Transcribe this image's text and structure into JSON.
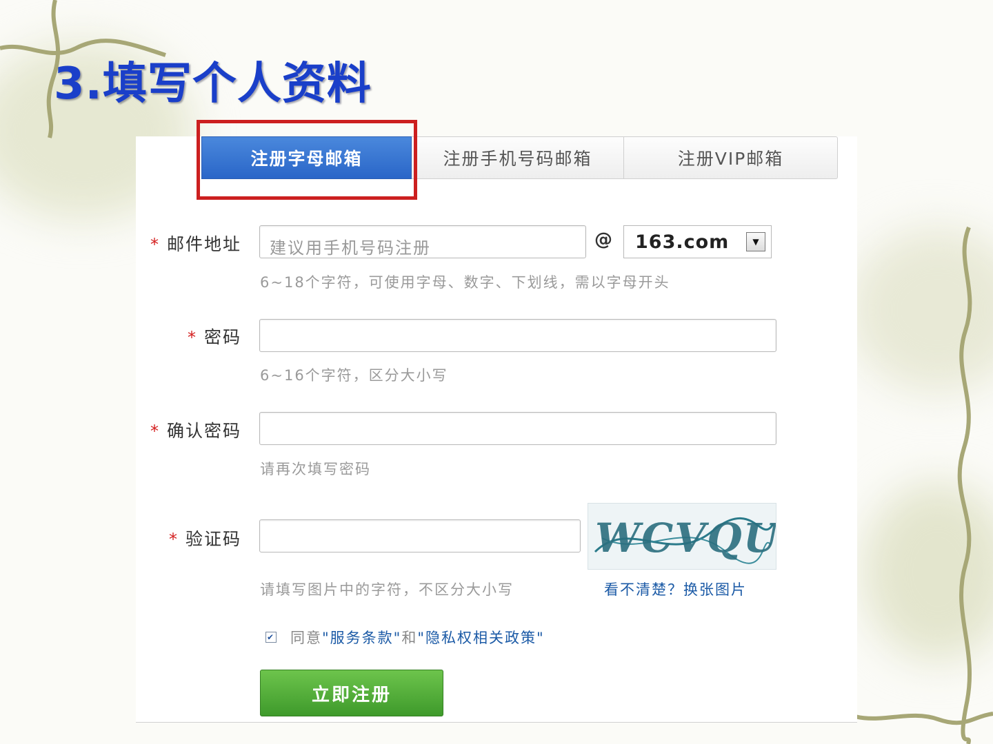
{
  "slide": {
    "title": "3.填写个人资料"
  },
  "tabs": [
    {
      "label": "注册字母邮箱",
      "active": true
    },
    {
      "label": "注册手机号码邮箱",
      "active": false
    },
    {
      "label": "注册VIP邮箱",
      "active": false
    }
  ],
  "form": {
    "required_mark": "*",
    "email": {
      "label": "邮件地址",
      "placeholder": "建议用手机号码注册",
      "at": "@",
      "domain": "163.com",
      "hint": "6~18个字符，可使用字母、数字、下划线，需以字母开头"
    },
    "password": {
      "label": "密码",
      "hint": "6~16个字符，区分大小写"
    },
    "confirm": {
      "label": "确认密码",
      "hint": "请再次填写密码"
    },
    "captcha": {
      "label": "验证码",
      "image_text": "WCVQUR",
      "hint": "请填写图片中的字符，不区分大小写",
      "refresh": "看不清楚？换张图片"
    },
    "agree": {
      "prefix": "同意",
      "terms": "\"服务条款\"",
      "and": "和",
      "privacy": "\"隐私权相关政策\""
    },
    "submit": "立即注册"
  },
  "colors": {
    "title": "#1a3fc9",
    "active_tab": "#2a66c8",
    "highlight": "#cc1f1f",
    "submit": "#4aa832",
    "link": "#1b5aa6"
  }
}
